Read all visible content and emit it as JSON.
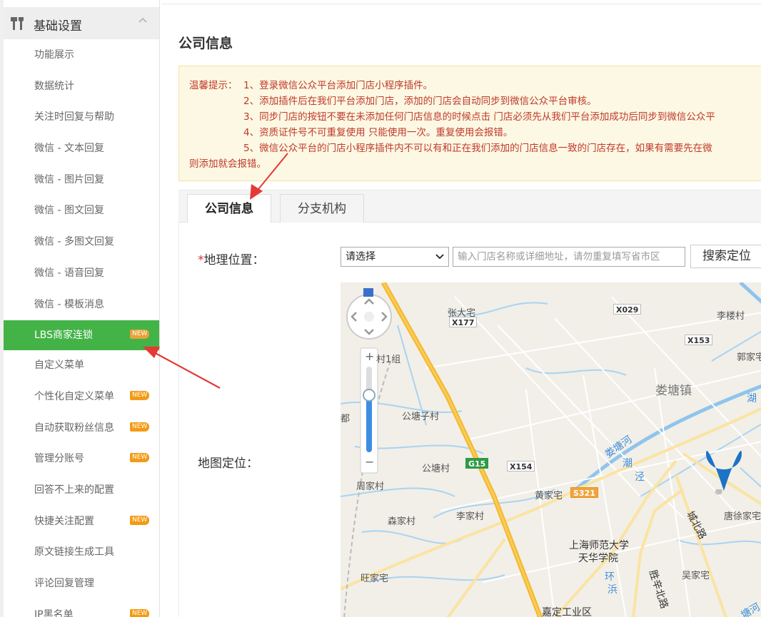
{
  "sidebar": {
    "group_title": "基础设置",
    "items": [
      {
        "label": "功能展示",
        "badge": ""
      },
      {
        "label": "数据统计",
        "badge": ""
      },
      {
        "label": "关注时回复与帮助",
        "badge": ""
      },
      {
        "label": "微信 - 文本回复",
        "badge": ""
      },
      {
        "label": "微信 - 图片回复",
        "badge": ""
      },
      {
        "label": "微信 - 图文回复",
        "badge": ""
      },
      {
        "label": "微信 - 多图文回复",
        "badge": ""
      },
      {
        "label": "微信 - 语音回复",
        "badge": ""
      },
      {
        "label": "微信 - 模板消息",
        "badge": ""
      },
      {
        "label": "LBS商家连锁",
        "badge": "NEW"
      },
      {
        "label": "自定义菜单",
        "badge": ""
      },
      {
        "label": "个性化自定义菜单",
        "badge": "NEW"
      },
      {
        "label": "自动获取粉丝信息",
        "badge": "NEW"
      },
      {
        "label": "管理分账号",
        "badge": "NEW"
      },
      {
        "label": "回答不上来的配置",
        "badge": ""
      },
      {
        "label": "快捷关注配置",
        "badge": "NEW"
      },
      {
        "label": "原文链接生成工具",
        "badge": ""
      },
      {
        "label": "评论回复管理",
        "badge": ""
      },
      {
        "label": "IP黑名单",
        "badge": "NEW"
      }
    ],
    "active_index": 9
  },
  "main": {
    "title": "公司信息",
    "notice": {
      "lead": "温馨提示：",
      "lines": [
        "1、登录微信公众平台添加门店小程序插件。",
        "2、添加插件后在我们平台添加门店，添加的门店会自动同步到微信公众平台审核。",
        "3、同步门店的按钮不要在未添加任何门店信息的时候点击 门店必须先从我们平台添加成功后同步到微信公众平",
        "4、资质证件号不可重复使用 只能使用一次。重复使用会报错。",
        "5、微信公众平台的门店小程序插件内不可以有和正在我们添加的门店信息一致的门店存在，如果有需要先在微"
      ],
      "tail": "则添加就会报错。"
    },
    "tabs": [
      {
        "label": "公司信息",
        "active": true
      },
      {
        "label": "分支机构",
        "active": false
      }
    ],
    "form": {
      "location_required": "*",
      "location_label": "地理位置：",
      "region_select_value": "请选择",
      "address_placeholder": "输入门店名称或详细地址，请勿重复填写省市区",
      "search_button": "搜索定位",
      "map_label": "地图定位："
    },
    "map": {
      "places": [
        "张大宅",
        "X029",
        "李楼村",
        "X177",
        "X153",
        "村1组",
        "郭家宅",
        "娄塘镇",
        "湖",
        "都",
        "公塘子村",
        "娄塘河",
        "潮",
        "泾",
        "公塘村",
        "G15",
        "X154",
        "周家村",
        "黄家宅",
        "S321",
        "城北路",
        "唐徐家宅",
        "森家村",
        "李家村",
        "上海师范大学",
        "天华学院",
        "吴家宅",
        "旺家宅",
        "胜辛北路",
        "嘉定工业区",
        "环",
        "浜",
        "塘河"
      ],
      "compass_icon": "map-pan-control-icon",
      "zoom_in": "+",
      "zoom_out": "−",
      "marker_icon": "map-pin-icon"
    }
  },
  "colors": {
    "active_menu": "#43b348",
    "badge": "#f29b15",
    "notice_text": "#c0392b",
    "notice_bg": "#fcf8e3",
    "annotation_arrow": "#e53935"
  }
}
